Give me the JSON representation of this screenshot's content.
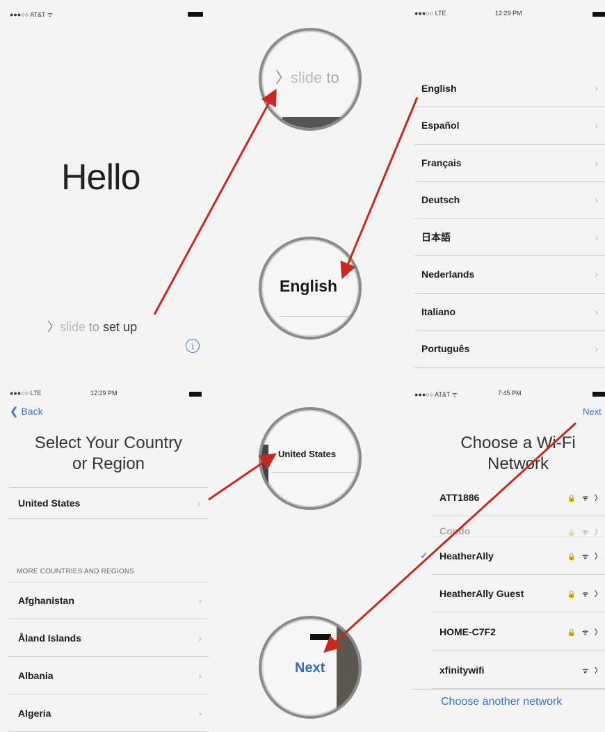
{
  "tl": {
    "carrier": "●●●○○ AT&T ᯤ",
    "hello": "Hello",
    "slide_chev": "〉",
    "slide_a": "slide",
    "slide_b": " to ",
    "slide_c": "set up",
    "info": "i"
  },
  "mag1": {
    "chev": "〉",
    "a": "slide",
    "b": " to"
  },
  "tr": {
    "status_left": "●●●○○  LTE",
    "time": "12:29 PM",
    "languages": [
      "English",
      "Español",
      "Français",
      "Deutsch",
      "日本語",
      "Nederlands",
      "Italiano",
      "Português"
    ]
  },
  "mag2": {
    "label": "English"
  },
  "bl": {
    "status_left": "●●●○○  LTE",
    "time": "12:29 PM",
    "back": "Back",
    "title_line1": "Select Your Country",
    "title_line2": "or Region",
    "selected": "United States",
    "section_header": "MORE COUNTRIES AND REGIONS",
    "countries": [
      "Afghanistan",
      "Åland Islands",
      "Albania",
      "Algeria"
    ]
  },
  "mag3": {
    "label": "United States"
  },
  "br": {
    "status_left": "●●●○○ AT&T ᯤ",
    "time": "7:45 PM",
    "next": "Next",
    "title_line1": "Choose a Wi-Fi",
    "title_line2": "Network",
    "networks": [
      {
        "name": "ATT1886",
        "icons": "🔒 ᯤ 〉"
      },
      {
        "name": "Condo",
        "icons": "🔒 ᯤ 〉"
      },
      {
        "name": "HeatherAlly",
        "icons": "🔒 ᯤ 〉"
      },
      {
        "name": "HeatherAlly Guest",
        "icons": "🔒 ᯤ 〉"
      },
      {
        "name": "HOME-C7F2",
        "icons": "🔒 ᯤ 〉"
      },
      {
        "name": "xfinitywifi",
        "icons": "ᯤ 〉"
      }
    ],
    "checkmark": "✓",
    "other": "Choose another network"
  },
  "mag4": {
    "label": "Next"
  },
  "colors": {
    "arrow": "#c8281e",
    "accent": "#3a72c8"
  }
}
